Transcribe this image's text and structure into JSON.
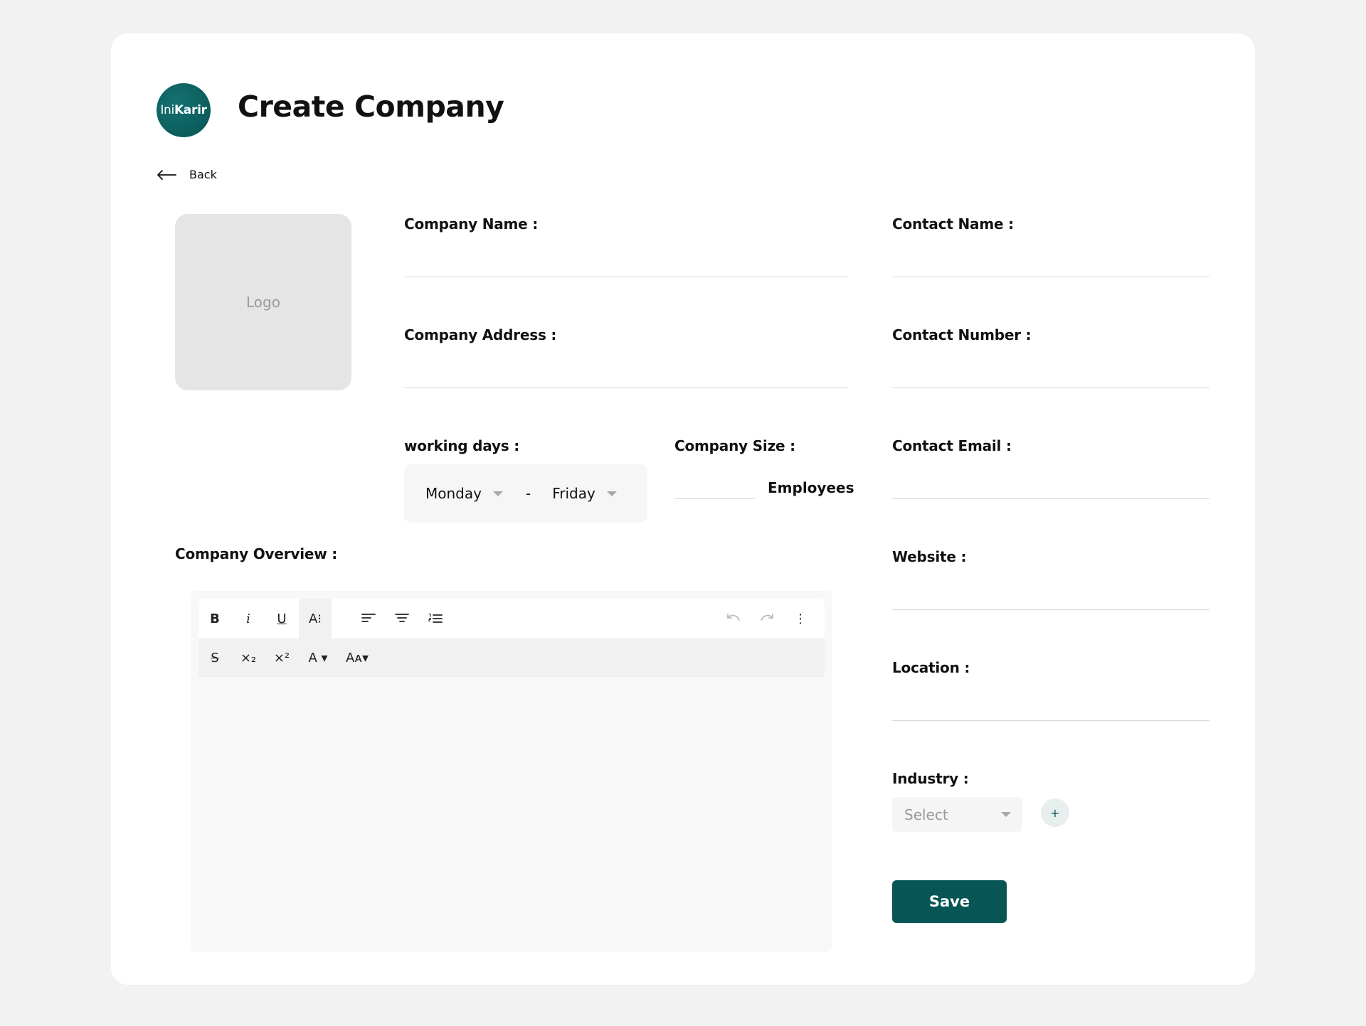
{
  "brand": {
    "logo_text_light": "Ini",
    "logo_text_bold": "Karir"
  },
  "page": {
    "title": "Create Company",
    "back_label": "Back"
  },
  "logo_upload": {
    "label": "Logo"
  },
  "form": {
    "company_name": {
      "label": "Company Name :",
      "value": ""
    },
    "company_address": {
      "label": "Company Address :",
      "value": ""
    },
    "working_days": {
      "label": "working days :",
      "from": "Monday",
      "separator": "-",
      "to": "Friday"
    },
    "company_size": {
      "label": "Company Size :",
      "value": "",
      "unit": "Employees"
    },
    "company_overview": {
      "label": "Company Overview :"
    },
    "contact_name": {
      "label": "Contact Name :",
      "value": ""
    },
    "contact_number": {
      "label": "Contact Number :",
      "value": ""
    },
    "contact_email": {
      "label": "Contact Email :",
      "value": ""
    },
    "website": {
      "label": "Website :",
      "value": ""
    },
    "location": {
      "label": "Location :",
      "value": ""
    },
    "industry": {
      "label": "Industry :",
      "selected": "Select",
      "add_label": "+"
    },
    "save_label": "Save"
  },
  "editor_toolbar": {
    "bold": "B",
    "italic": "i",
    "underline": "U",
    "font_style": "A⁝",
    "strikethrough": "S",
    "subscript": "×₂",
    "superscript": "×²",
    "font_color": "A ▾",
    "font_size": "Aᴀ▾",
    "more": "⋮"
  },
  "colors": {
    "accent": "#075555",
    "background": "#f2f2f2",
    "card": "#ffffff"
  }
}
